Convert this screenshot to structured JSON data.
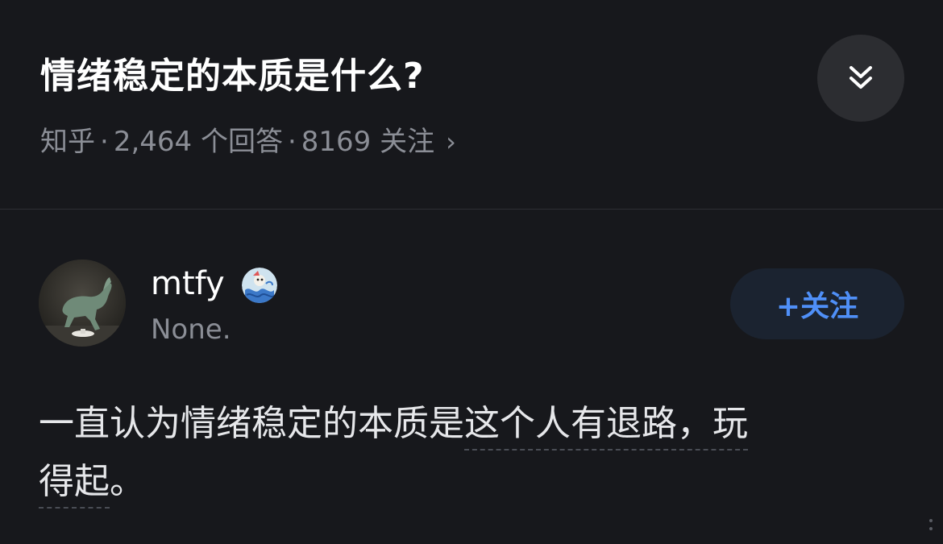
{
  "question": {
    "title": "情绪稳定的本质是什么?",
    "source": "知乎",
    "answers_count": "2,464 个回答",
    "followers_count": "8169 关注",
    "meta_separator": "·",
    "chevron_glyph": "›"
  },
  "author": {
    "name": "mtfy",
    "bio": "None."
  },
  "follow_button": {
    "label": "+关注"
  },
  "answer": {
    "line1_plain": "一直认为情绪稳定的本质是",
    "line1_highlight": "这个人有退路，玩",
    "line2_highlight": "得起",
    "line2_plain": "。"
  },
  "icons": {
    "expand": "double-chevron-down-icon",
    "chevron": "chevron-right-icon",
    "more": "more-dots-icon"
  },
  "colors": {
    "background": "#17181c",
    "accent_blue": "#4f8ff7",
    "muted_text": "#8b8e96",
    "follow_button_bg": "#1b2330"
  }
}
